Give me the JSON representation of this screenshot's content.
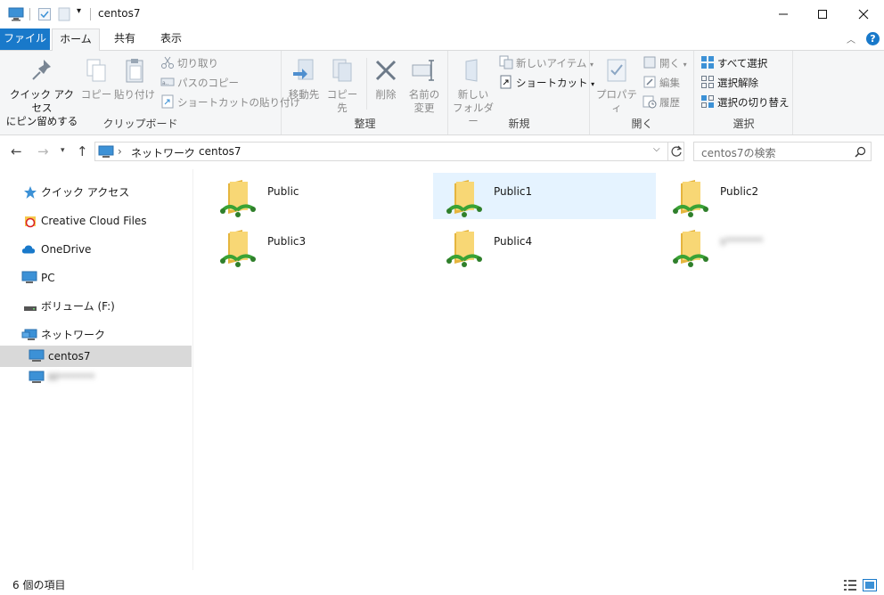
{
  "window": {
    "title": "centos7",
    "controls": {
      "minimize": "—",
      "maximize": "☐",
      "close": "✕"
    }
  },
  "ribbon_tabs": {
    "file": "ファイル",
    "home": "ホーム",
    "share": "共有",
    "view": "表示"
  },
  "ribbon": {
    "clipboard": {
      "label": "クリップボード",
      "pin_quick_access_line1": "クイック アクセス",
      "pin_quick_access_line2": "にピン留めする",
      "copy": "コピー",
      "paste": "貼り付け",
      "cut": "切り取り",
      "copy_path": "パスのコピー",
      "paste_shortcut": "ショートカットの貼り付け"
    },
    "organize": {
      "label": "整理",
      "move_to": "移動先",
      "copy_to": "コピー先",
      "delete": "削除",
      "rename_line1": "名前の",
      "rename_line2": "変更"
    },
    "new": {
      "label": "新規",
      "new_folder_line1": "新しい",
      "new_folder_line2": "フォルダー",
      "new_item": "新しいアイテム",
      "shortcut": "ショートカット"
    },
    "open": {
      "label": "開く",
      "properties": "プロパティ",
      "open": "開く",
      "edit": "編集",
      "history": "履歴"
    },
    "select": {
      "label": "選択",
      "select_all": "すべて選択",
      "select_none": "選択解除",
      "invert": "選択の切り替え"
    }
  },
  "address": {
    "segments": [
      "ネットワーク",
      "centos7"
    ],
    "separator": "›",
    "search_placeholder": "centos7の検索"
  },
  "navpane": {
    "items": [
      {
        "label": "クイック アクセス",
        "icon": "star-icon"
      },
      {
        "label": "Creative Cloud Files",
        "icon": "creative-cloud-icon"
      },
      {
        "label": "OneDrive",
        "icon": "cloud-icon"
      },
      {
        "label": "PC",
        "icon": "computer-icon"
      },
      {
        "label": "ボリューム (F:)",
        "icon": "drive-icon"
      },
      {
        "label": "ネットワーク",
        "icon": "network-icon"
      },
      {
        "label": "centos7",
        "icon": "monitor-icon",
        "selected": true
      },
      {
        "label": "M*******",
        "icon": "monitor-icon",
        "blurred": true
      }
    ]
  },
  "content": {
    "items": [
      {
        "name": "Public",
        "selected": false
      },
      {
        "name": "Public1",
        "selected": true
      },
      {
        "name": "Public2",
        "selected": false
      },
      {
        "name": "Public3",
        "selected": false
      },
      {
        "name": "Public4",
        "selected": false
      },
      {
        "name": "s*******",
        "selected": false,
        "blurred": true
      }
    ]
  },
  "status": {
    "item_count": "6 個の項目"
  },
  "colors": {
    "accent": "#1979ca",
    "folder": "#f5c94c",
    "share_green": "#3aa335",
    "selection": "#e5f3ff"
  }
}
